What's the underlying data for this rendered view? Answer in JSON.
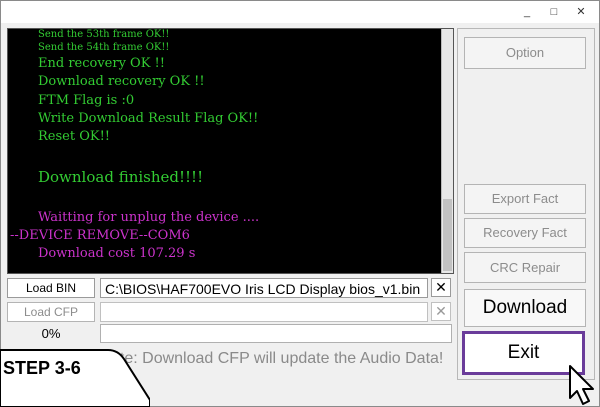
{
  "window": {
    "minimize_icon": "minimize-icon",
    "maximize_icon": "maximize-icon",
    "close_icon": "close-icon",
    "minimize_glyph": "_",
    "maximize_glyph": "□",
    "close_glyph": "✕"
  },
  "console": {
    "lines": [
      {
        "text": "Send the 53th frame OK!!",
        "color": "#33cc33"
      },
      {
        "text": "Send the 54th frame OK!!",
        "color": "#33cc33"
      },
      {
        "text": "End recovery OK !!",
        "color": "#33cc33"
      },
      {
        "text": "Download recovery OK !!",
        "color": "#33cc33"
      },
      {
        "text": "FTM Flag is :0",
        "color": "#33cc33"
      },
      {
        "text": "Write Download Result Flag OK!!",
        "color": "#33cc33"
      },
      {
        "text": "Reset OK!!",
        "color": "#33cc33"
      },
      {
        "text": "Download finished!!!!",
        "color": "#33cc33"
      },
      {
        "text": "Waitting for unplug the device ....",
        "color": "#cc33cc"
      },
      {
        "text": "--DEVICE REMOVE--COM6",
        "color": "#cc33cc"
      },
      {
        "text": "Download cost 107.29 s",
        "color": "#cc33cc"
      }
    ]
  },
  "right_panel": {
    "option": "Option",
    "export_fact": "Export Fact",
    "recovery_fact": "Recovery Fact",
    "crc_repair": "CRC Repair",
    "download": "Download",
    "exit": "Exit"
  },
  "bottom": {
    "load_bin": "Load BIN",
    "bin_path": "C:\\BIOS\\HAF700EVO Iris LCD Display bios_v1.bin",
    "load_cfp": "Load CFP",
    "cfp_path": "",
    "progress": "0%",
    "note": "ate: Download CFP will update the Audio Data!",
    "clear_glyph": "✕"
  },
  "overlay": {
    "step_label": "STEP 3-6",
    "cursor_icon": "mouse-pointer-icon"
  },
  "colors": {
    "console_bg": "#000000",
    "console_green": "#33cc33",
    "console_magenta": "#cc33cc",
    "highlight_border": "#6a3c9a"
  }
}
